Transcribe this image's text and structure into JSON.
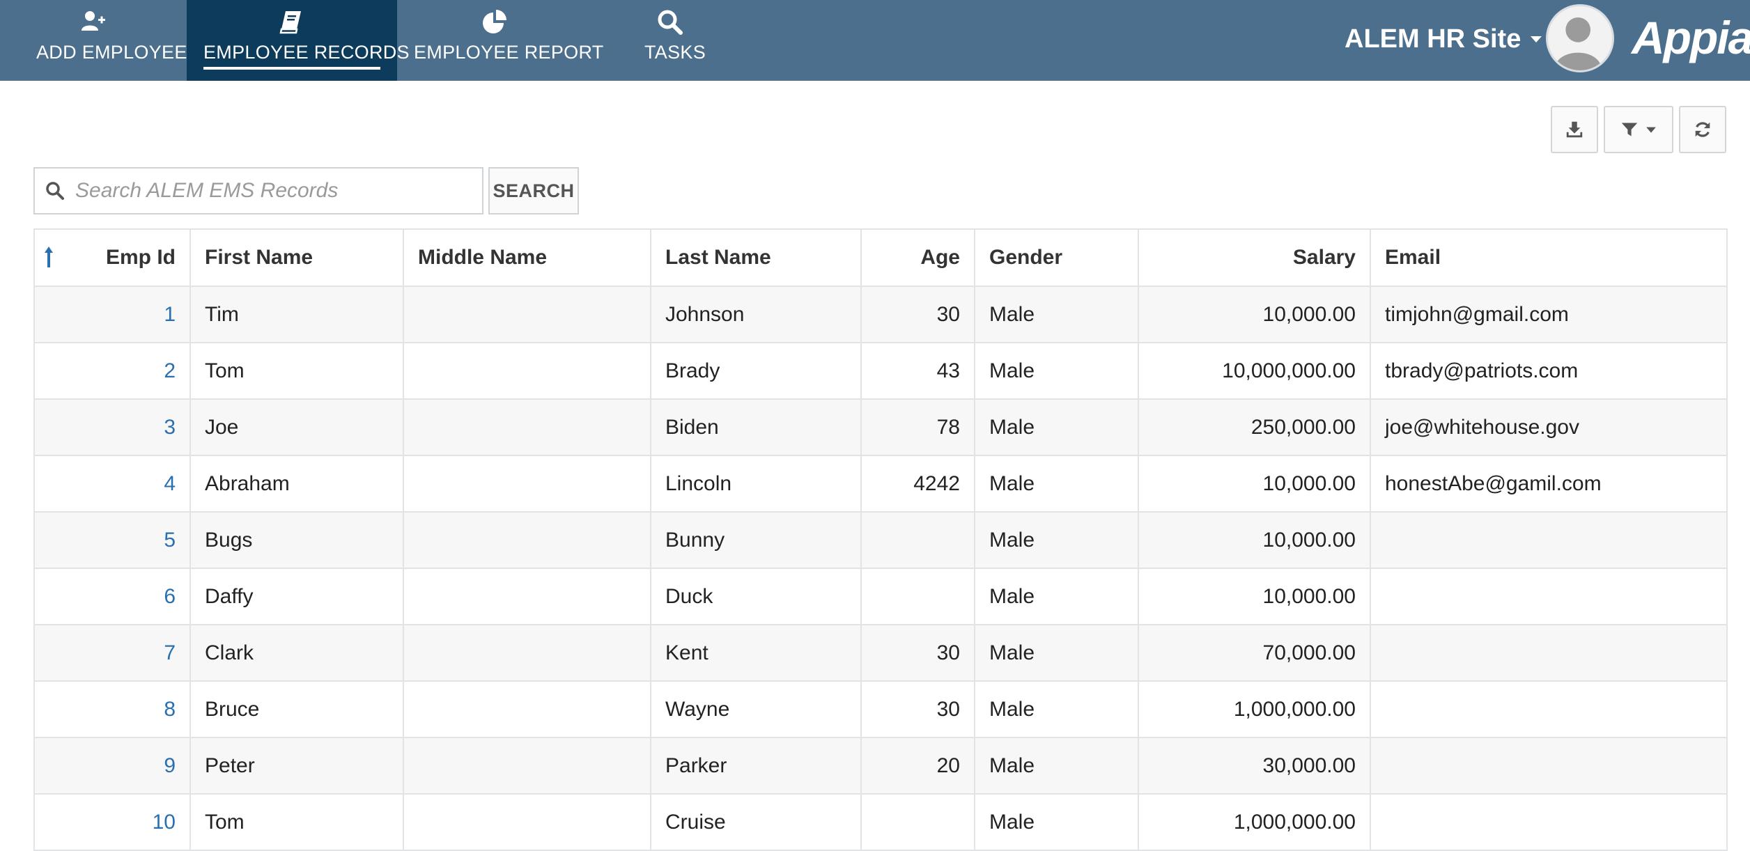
{
  "nav": {
    "tabs": [
      {
        "label": "ADD EMPLOYEE",
        "icon": "add-user-icon"
      },
      {
        "label": "EMPLOYEE RECORDS",
        "icon": "book-icon",
        "active": true
      },
      {
        "label": "EMPLOYEE REPORT",
        "icon": "pie-chart-icon"
      },
      {
        "label": "TASKS",
        "icon": "search-icon"
      }
    ],
    "site_name": "ALEM HR Site",
    "brand": "Appian"
  },
  "colors": {
    "header_bg": "#4b6f8c",
    "active_tab_bg": "#0d3b5c",
    "link": "#2a6fb0"
  },
  "toolbar": {
    "download_icon": "download-icon",
    "filter_icon": "filter-icon",
    "refresh_icon": "refresh-icon"
  },
  "search": {
    "placeholder": "Search ALEM EMS Records",
    "value": "",
    "button_label": "SEARCH"
  },
  "grid": {
    "sort": {
      "column": "Emp Id",
      "direction": "ascending"
    },
    "columns": [
      "Emp Id",
      "First Name",
      "Middle Name",
      "Last Name",
      "Age",
      "Gender",
      "Salary",
      "Email"
    ],
    "rows": [
      {
        "id": "1",
        "first": "Tim",
        "middle": "",
        "last": "Johnson",
        "age": "30",
        "gender": "Male",
        "salary": "10,000.00",
        "email": "timjohn@gmail.com"
      },
      {
        "id": "2",
        "first": "Tom",
        "middle": "",
        "last": "Brady",
        "age": "43",
        "gender": "Male",
        "salary": "10,000,000.00",
        "email": "tbrady@patriots.com"
      },
      {
        "id": "3",
        "first": "Joe",
        "middle": "",
        "last": "Biden",
        "age": "78",
        "gender": "Male",
        "salary": "250,000.00",
        "email": "joe@whitehouse.gov"
      },
      {
        "id": "4",
        "first": "Abraham",
        "middle": "",
        "last": "Lincoln",
        "age": "4242",
        "gender": "Male",
        "salary": "10,000.00",
        "email": "honestAbe@gamil.com"
      },
      {
        "id": "5",
        "first": "Bugs",
        "middle": "",
        "last": "Bunny",
        "age": "",
        "gender": "Male",
        "salary": "10,000.00",
        "email": ""
      },
      {
        "id": "6",
        "first": "Daffy",
        "middle": "",
        "last": "Duck",
        "age": "",
        "gender": "Male",
        "salary": "10,000.00",
        "email": ""
      },
      {
        "id": "7",
        "first": "Clark",
        "middle": "",
        "last": "Kent",
        "age": "30",
        "gender": "Male",
        "salary": "70,000.00",
        "email": ""
      },
      {
        "id": "8",
        "first": "Bruce",
        "middle": "",
        "last": "Wayne",
        "age": "30",
        "gender": "Male",
        "salary": "1,000,000.00",
        "email": ""
      },
      {
        "id": "9",
        "first": "Peter",
        "middle": "",
        "last": "Parker",
        "age": "20",
        "gender": "Male",
        "salary": "30,000.00",
        "email": ""
      },
      {
        "id": "10",
        "first": "Tom",
        "middle": "",
        "last": "Cruise",
        "age": "",
        "gender": "Male",
        "salary": "1,000,000.00",
        "email": ""
      }
    ]
  }
}
